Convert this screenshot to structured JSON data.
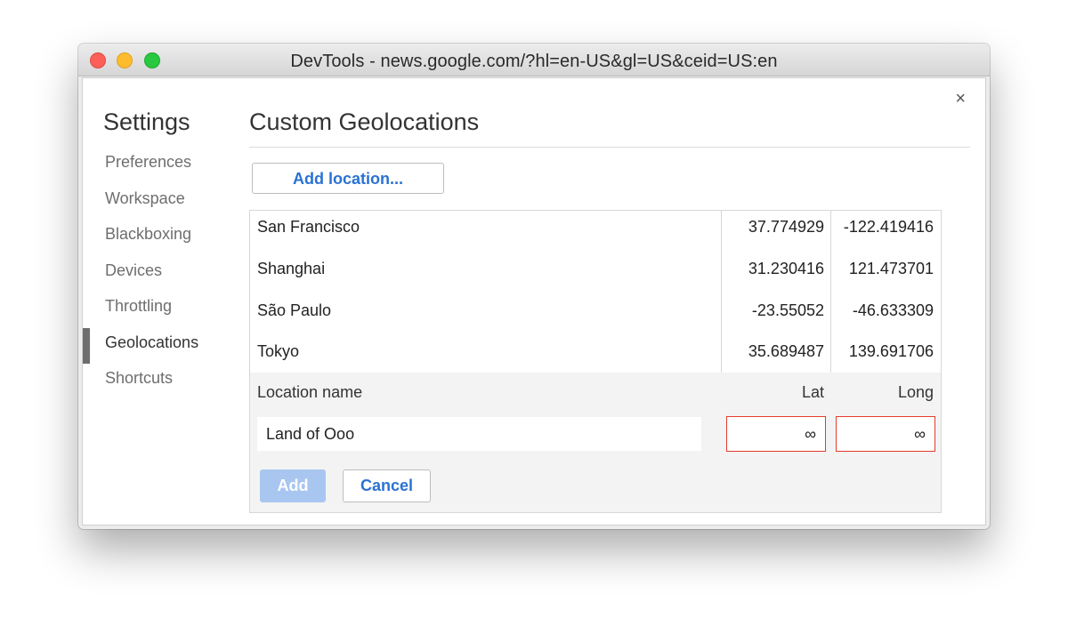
{
  "window": {
    "title": "DevTools - news.google.com/?hl=en-US&gl=US&ceid=US:en",
    "close_glyph": "×"
  },
  "settings": {
    "title": "Settings",
    "nav": [
      {
        "label": "Preferences",
        "selected": false
      },
      {
        "label": "Workspace",
        "selected": false
      },
      {
        "label": "Blackboxing",
        "selected": false
      },
      {
        "label": "Devices",
        "selected": false
      },
      {
        "label": "Throttling",
        "selected": false
      },
      {
        "label": "Geolocations",
        "selected": true
      },
      {
        "label": "Shortcuts",
        "selected": false
      }
    ]
  },
  "panel": {
    "title": "Custom Geolocations",
    "add_location_label": "Add location...",
    "locations": [
      {
        "name": "San Francisco",
        "lat": "37.774929",
        "long": "-122.419416"
      },
      {
        "name": "Shanghai",
        "lat": "31.230416",
        "long": "121.473701"
      },
      {
        "name": "São Paulo",
        "lat": "-23.55052",
        "long": "-46.633309"
      },
      {
        "name": "Tokyo",
        "lat": "35.689487",
        "long": "139.691706"
      }
    ],
    "editor": {
      "name_label": "Location name",
      "lat_label": "Lat",
      "long_label": "Long",
      "name_value": "Land of Ooo",
      "lat_value": "∞",
      "long_value": "∞",
      "add_label": "Add",
      "cancel_label": "Cancel"
    }
  },
  "colors": {
    "accent_blue": "#2a72d3",
    "invalid_border": "#e33b2e",
    "disabled_button": "#a8c6f0"
  }
}
